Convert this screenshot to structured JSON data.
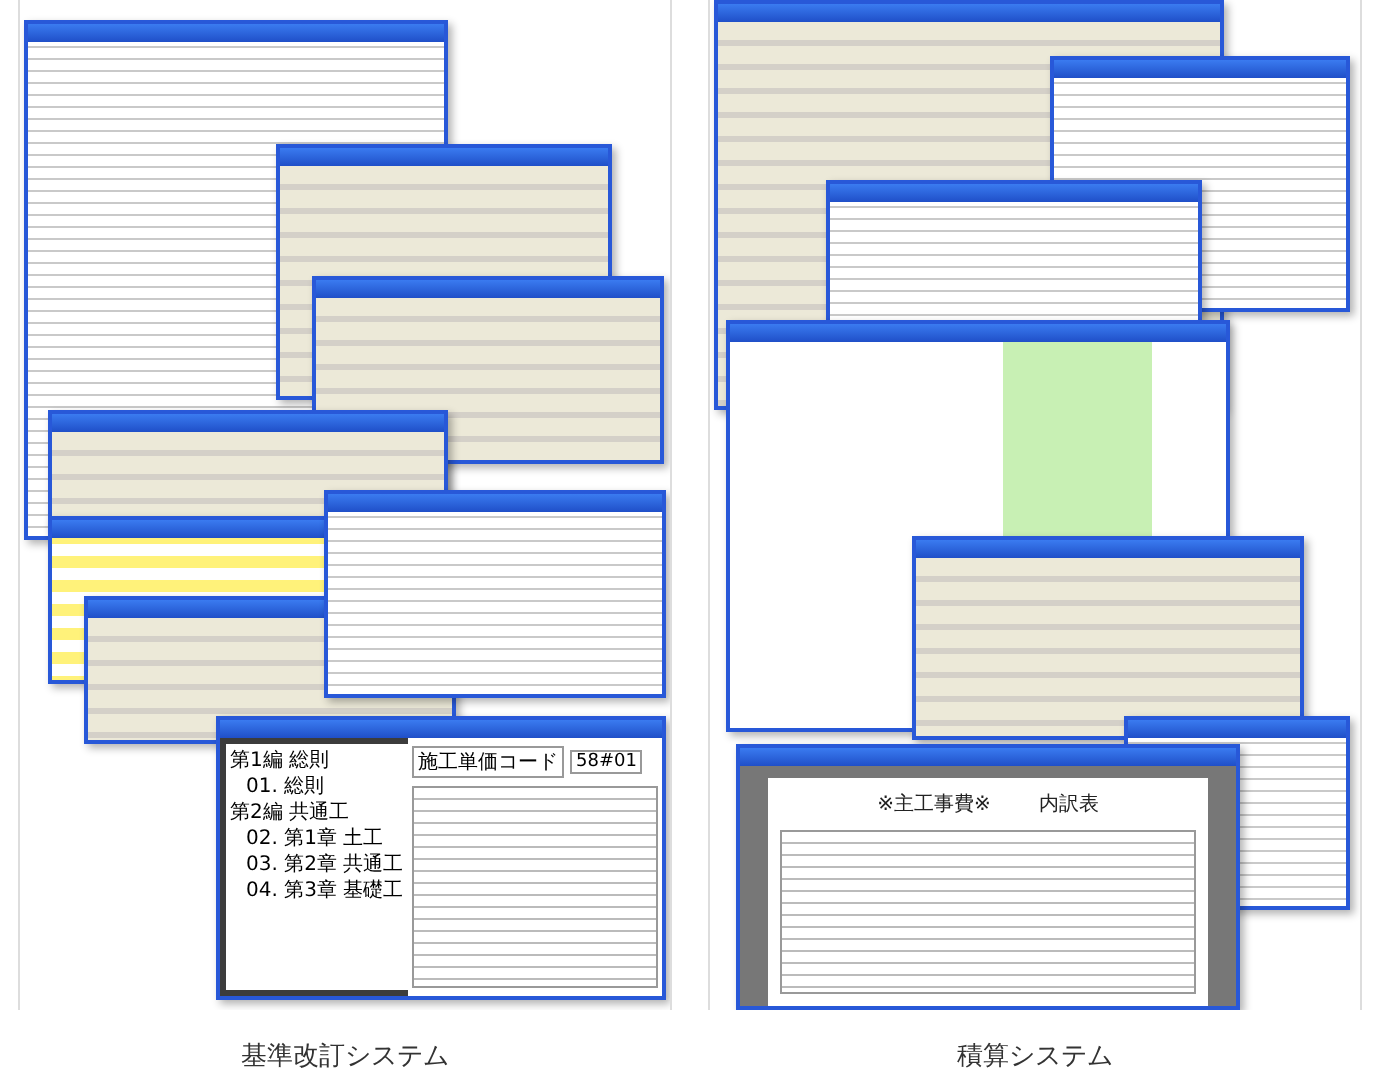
{
  "panels": [
    {
      "caption": "基準改訂システム",
      "pdf_viewer": {
        "heading": "施工単価コード",
        "code": "58#01",
        "tree": [
          {
            "label": "第1編 総則",
            "children": [
              {
                "label": "01. 総則"
              }
            ]
          },
          {
            "label": "第2編 共通工",
            "children": [
              {
                "label": "02. 第1章 土工"
              },
              {
                "label": "03. 第2章 共通工"
              },
              {
                "label": "04. 第3章 基礎工"
              }
            ]
          }
        ]
      }
    },
    {
      "caption": "積算システム",
      "report": {
        "title": "※主工事費※",
        "subtitle": "内訳表"
      }
    }
  ]
}
